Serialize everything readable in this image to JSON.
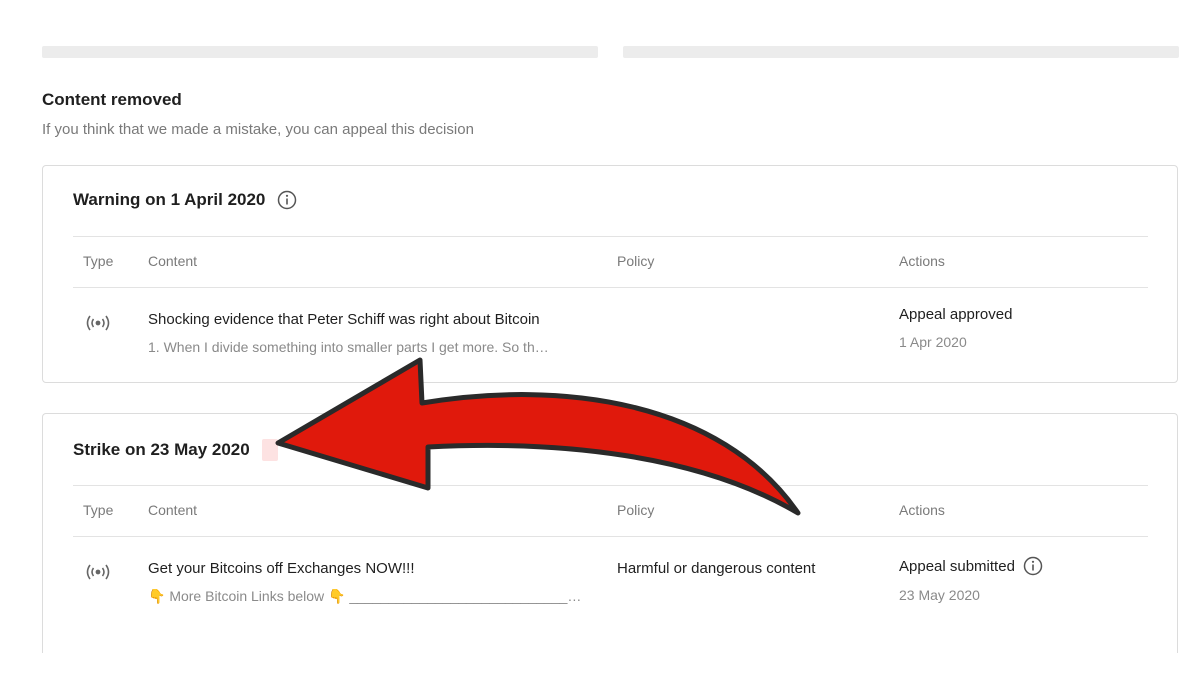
{
  "section": {
    "title": "Content removed",
    "subtitle": "If you think that we made a mistake, you can appeal this decision"
  },
  "columns": {
    "type": "Type",
    "content": "Content",
    "policy": "Policy",
    "actions": "Actions"
  },
  "cards": [
    {
      "title": "Warning on 1 April 2020",
      "icon": "info-icon",
      "row": {
        "type_icon": "live-broadcast-icon",
        "title": "Shocking evidence that Peter Schiff was right about Bitcoin",
        "description": "1. When I divide something into smaller parts I get more. So th…",
        "policy": "",
        "action": "Appeal approved",
        "date": "1 Apr 2020"
      }
    },
    {
      "title": "Strike on 23 May 2020",
      "badge": "",
      "row": {
        "type_icon": "live-broadcast-icon",
        "title": "Get your Bitcoins off Exchanges NOW!!!",
        "description": "👇 More Bitcoin Links below 👇 ____________________________…",
        "policy": "Harmful or dangerous content",
        "action": "Appeal submitted",
        "action_icon": "info-icon",
        "date": "23 May 2020"
      }
    }
  ],
  "annotation": {
    "arrow_color": "#e0190c",
    "arrow_outline": "#2a2a2a"
  }
}
